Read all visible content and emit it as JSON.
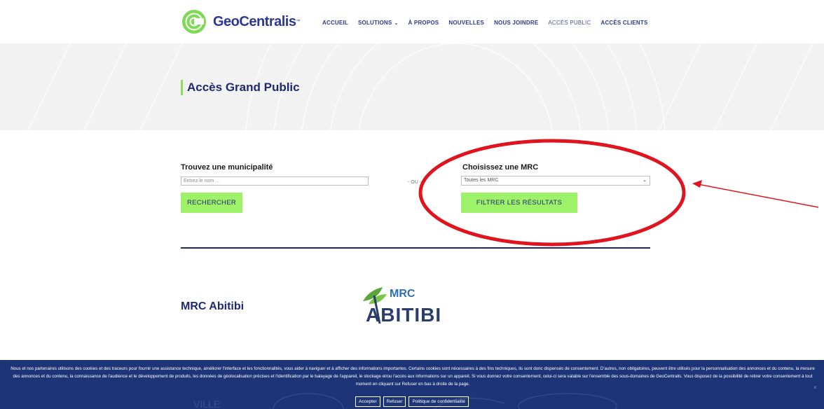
{
  "header": {
    "logo_text": "GeoCentralis",
    "logo_tm": "™",
    "nav": [
      {
        "label": "ACCUEIL"
      },
      {
        "label": "SOLUTIONS"
      },
      {
        "label": "À PROPOS"
      },
      {
        "label": "NOUVELLES"
      },
      {
        "label": "NOUS JOINDRE"
      },
      {
        "label": "ACCÈS PUBLIC"
      },
      {
        "label": "ACCÈS CLIENTS"
      }
    ]
  },
  "hero": {
    "title": "Accès Grand Public"
  },
  "search": {
    "municipality_label": "Trouvez une municipalité",
    "municipality_placeholder": "Entrez le nom ...",
    "search_button": "RECHERCHER",
    "or_text": "- OU -",
    "mrc_label": "Choisissez une MRC",
    "mrc_selected": "Toutes les MRC",
    "filter_button": "FILTRER LES RÉSULTATS"
  },
  "results": {
    "mrc_title": "MRC Abitibi",
    "logo_small": "MRC",
    "logo_big": "ABITIBI"
  },
  "cookie_banner": {
    "text": "Nous et nos partenaires utilisons des cookies et des traceurs pour fournir une assistance technique, améliorer l'interface et les fonctionnalités, vous aider à naviguer et à afficher des informations importantes. Certains cookies sont nécessaires à des fins techniques, ils sont donc dispensés de consentement. D'autres, non obligatoires, peuvent être utilisés pour la personnalisation des annonces et du contenu, la mesure des annonces et du contenu, la connaissance de l'audience et le développement de produits, les données de géolocalisation précises et l'identification par le balayage de l'appareil, le stockage et/ou l'accès aux informations sur un appareil. Si vous donnez votre consentement, celui-ci sera valable sur l'ensemble des sous-domaines de GeoCentralis. Vous disposez de la possibilité de retirer votre consentement à tout moment en cliquant sur Refuser en bas à droite de la page.",
    "accept": "Accepter",
    "refuse": "Refuser",
    "policy": "Politique de confidentialité",
    "close": "×"
  },
  "colors": {
    "accent_green": "#9df26a",
    "brand_blue": "#1f2a6e",
    "annotation_red": "#e0141e",
    "banner_blue": "#1d3476"
  }
}
